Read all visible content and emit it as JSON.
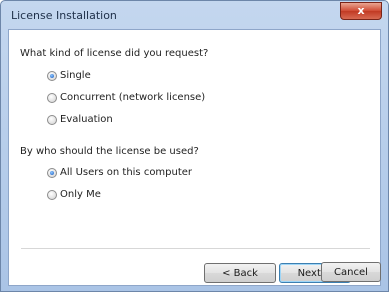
{
  "window": {
    "title": "License Installation",
    "close_glyph": "x"
  },
  "q1": {
    "prompt": "What kind of license did you request?",
    "options": [
      {
        "label": "Single",
        "checked": true
      },
      {
        "label": "Concurrent (network license)",
        "checked": false
      },
      {
        "label": "Evaluation",
        "checked": false
      }
    ]
  },
  "q2": {
    "prompt": "By who should the license be used?",
    "options": [
      {
        "label": "All Users on this computer",
        "checked": true
      },
      {
        "label": "Only Me",
        "checked": false
      }
    ]
  },
  "buttons": {
    "back": "< Back",
    "next": "Next >",
    "cancel": "Cancel"
  },
  "colors": {
    "accent": "#1f5fbf",
    "frame": "#aac4e6",
    "close": "#c13a23"
  }
}
